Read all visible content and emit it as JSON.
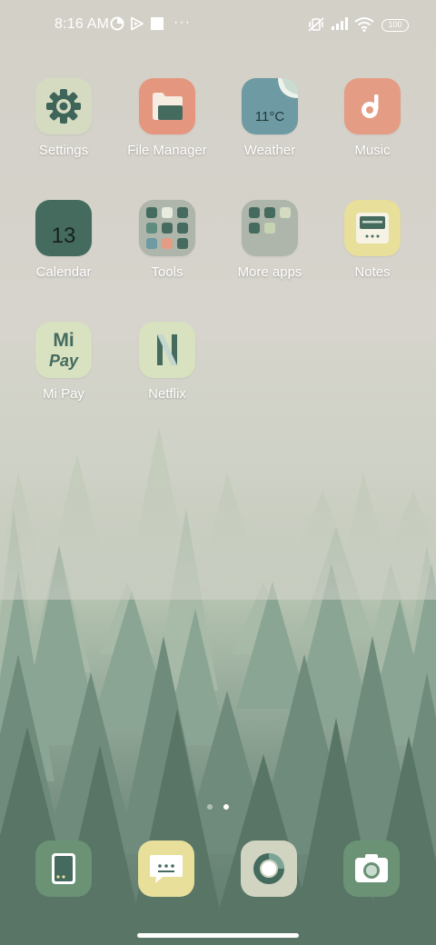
{
  "status_bar": {
    "time": "8:16 AM",
    "left_icons": [
      "data-saver-icon",
      "play-protect-icon",
      "stop-icon",
      "more-icon"
    ],
    "more_text": "···",
    "right_icons": [
      "vibrate-off-icon",
      "signal-icon",
      "wifi-icon",
      "battery-icon"
    ],
    "battery": "100"
  },
  "home_apps": [
    {
      "label": "Settings",
      "icon": "gear-icon",
      "bg": "#d5dbc0"
    },
    {
      "label": "File Manager",
      "icon": "folder-icon",
      "bg": "#e4977e"
    },
    {
      "label": "Weather",
      "icon": "weather-icon",
      "bg": "#6d9aa3",
      "text": "11°C"
    },
    {
      "label": "Music",
      "icon": "music-note-icon",
      "bg": "#e49c84"
    },
    {
      "label": "Calendar",
      "icon": "calendar-icon",
      "bg": "#456b5f",
      "text": "13"
    },
    {
      "label": "Tools",
      "icon": "folder-tools-icon",
      "bg": "#aeb5ab"
    },
    {
      "label": "More apps",
      "icon": "folder-more-apps-icon",
      "bg": "#aeb5ab"
    },
    {
      "label": "Notes",
      "icon": "notes-icon",
      "bg": "#e8df9a"
    },
    {
      "label": "Mi Pay",
      "icon": "mi-pay-icon",
      "bg": "#d8e1c0",
      "text_top": "Mi",
      "text_bottom": "Pay"
    },
    {
      "label": "Netflix",
      "icon": "netflix-icon",
      "bg": "#d8e1c0"
    }
  ],
  "dock": [
    {
      "name": "phone-icon",
      "bg": "#6b9275"
    },
    {
      "name": "messages-icon",
      "bg": "#e8df9a"
    },
    {
      "name": "browser-icon",
      "bg": "#d0d4c0"
    },
    {
      "name": "camera-icon",
      "bg": "#6b9275"
    }
  ],
  "page_indicator": {
    "total": 2,
    "current": 2
  },
  "colors": {
    "dark_green": "#456b5f",
    "label_text": "#ffffff",
    "wallpaper_top": "#d3d0c8",
    "forest": "#5f7b6d"
  }
}
